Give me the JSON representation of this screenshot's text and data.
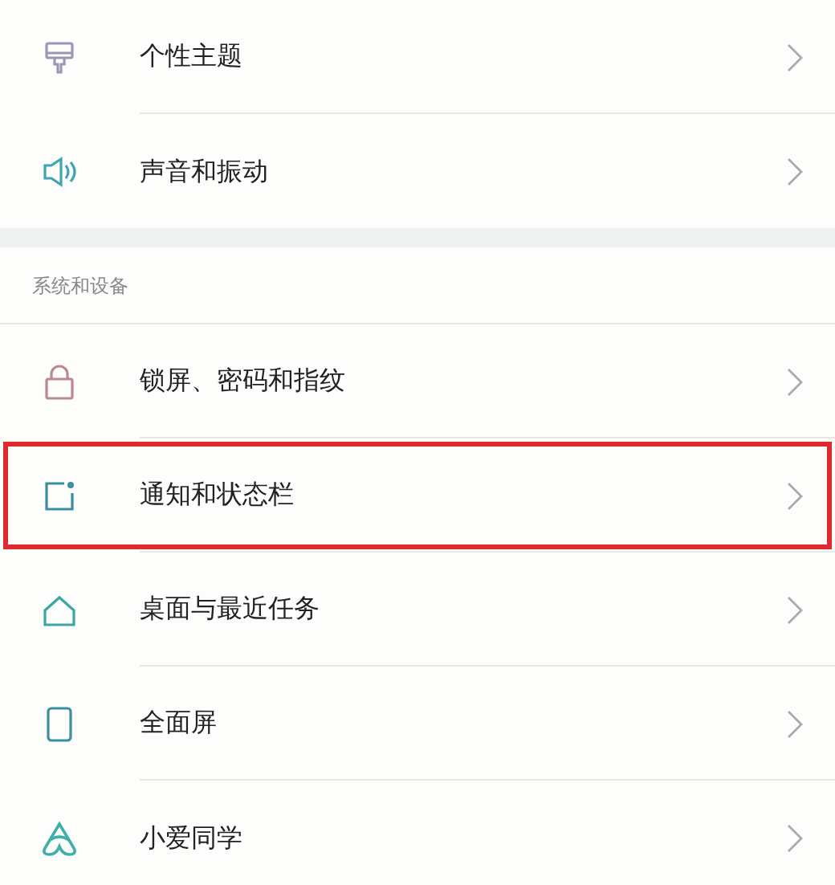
{
  "sections": [
    {
      "items": [
        {
          "label": "个性主题",
          "highlighted": false
        },
        {
          "label": "声音和振动",
          "highlighted": false
        }
      ]
    },
    {
      "header": "系统和设备",
      "items": [
        {
          "label": "锁屏、密码和指纹",
          "highlighted": false
        },
        {
          "label": "通知和状态栏",
          "highlighted": true
        },
        {
          "label": "桌面与最近任务",
          "highlighted": false
        },
        {
          "label": "全面屏",
          "highlighted": false
        },
        {
          "label": "小爱同学",
          "highlighted": false
        }
      ]
    }
  ]
}
